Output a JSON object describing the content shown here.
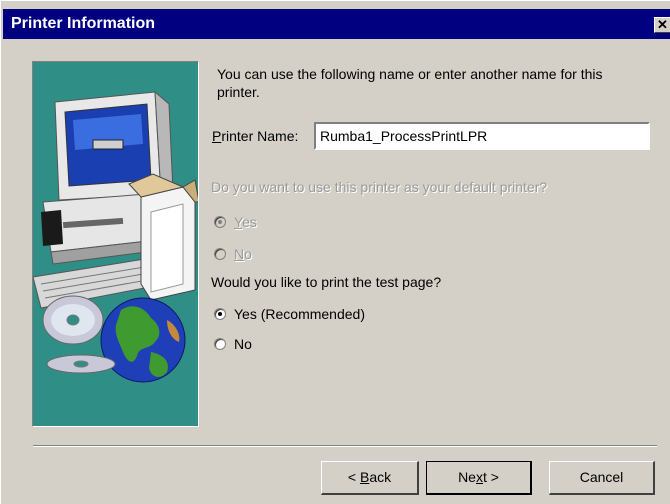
{
  "window": {
    "title": "Printer Information",
    "close_glyph": "✕"
  },
  "intro_text": "You can use the following name or enter another name for this printer.",
  "printer_name": {
    "label_prefix": "",
    "label_accel": "P",
    "label_rest": "rinter Name:",
    "value": "Rumba1_ProcessPrintLPR"
  },
  "default_printer": {
    "question": "Do you want to use this printer as your default printer?",
    "enabled": false,
    "options": [
      {
        "accel": "Y",
        "rest": "es",
        "checked": true
      },
      {
        "accel": "N",
        "rest": "o",
        "checked": false
      }
    ]
  },
  "test_page": {
    "question": "Would you like to print the test page?",
    "options": [
      {
        "label": "Yes (Recommended)",
        "checked": true
      },
      {
        "label": "No",
        "checked": false
      }
    ]
  },
  "buttons": {
    "back": {
      "pre": "< ",
      "accel": "B",
      "rest": "ack"
    },
    "next": {
      "pre": "Ne",
      "accel": "x",
      "rest": "t >"
    },
    "cancel": {
      "label": "Cancel"
    }
  },
  "illustration": {
    "name": "computer-and-globe-illustration",
    "background": "#2f8f86"
  }
}
